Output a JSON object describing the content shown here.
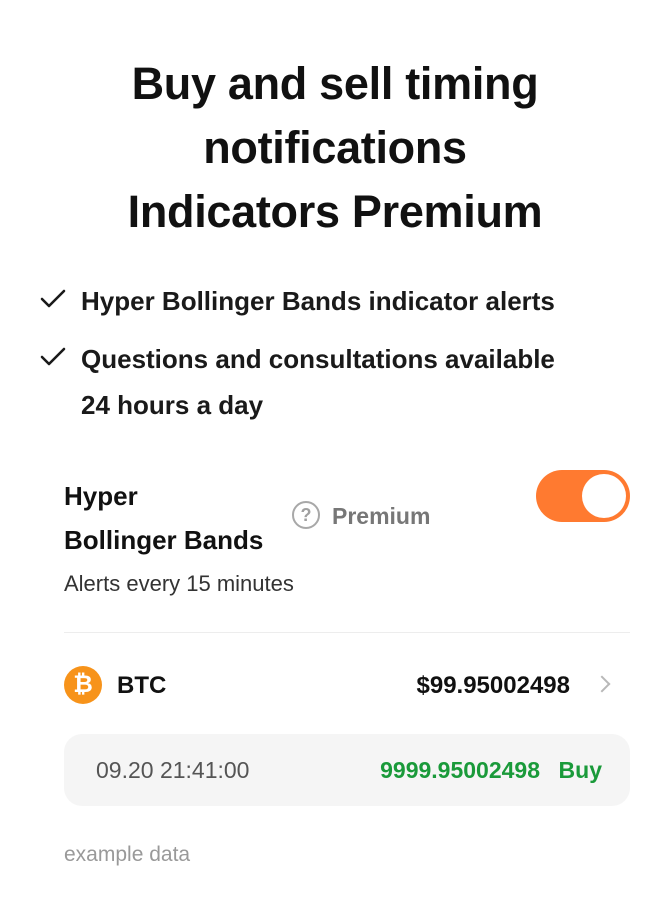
{
  "header": {
    "title_lines": [
      "Buy and sell timing",
      "notifications",
      "Indicators Premium"
    ]
  },
  "features": [
    {
      "icon": "check-icon",
      "lines": [
        "Hyper Bollinger Bands indicator alerts"
      ]
    },
    {
      "icon": "check-icon",
      "lines": [
        "Questions and consultations available",
        "24 hours a day"
      ]
    }
  ],
  "indicator": {
    "name_lines": [
      "Hyper",
      "Bollinger Bands"
    ],
    "help_icon": "question-circle-icon",
    "help_glyph": "?",
    "badge": "Premium",
    "alerts_text": "Alerts every 15 minutes",
    "toggle_on": true,
    "toggle_color": "#ff7a30"
  },
  "coin": {
    "icon": "bitcoin-icon",
    "icon_glyph": "₿",
    "icon_color": "#f7931a",
    "symbol": "BTC",
    "price": "$99.95002498"
  },
  "signal": {
    "time": "09.20 21:41:00",
    "price": "9999.95002498",
    "action": "Buy",
    "action_color": "#1a9a3a"
  },
  "footer": {
    "note": "example data"
  }
}
